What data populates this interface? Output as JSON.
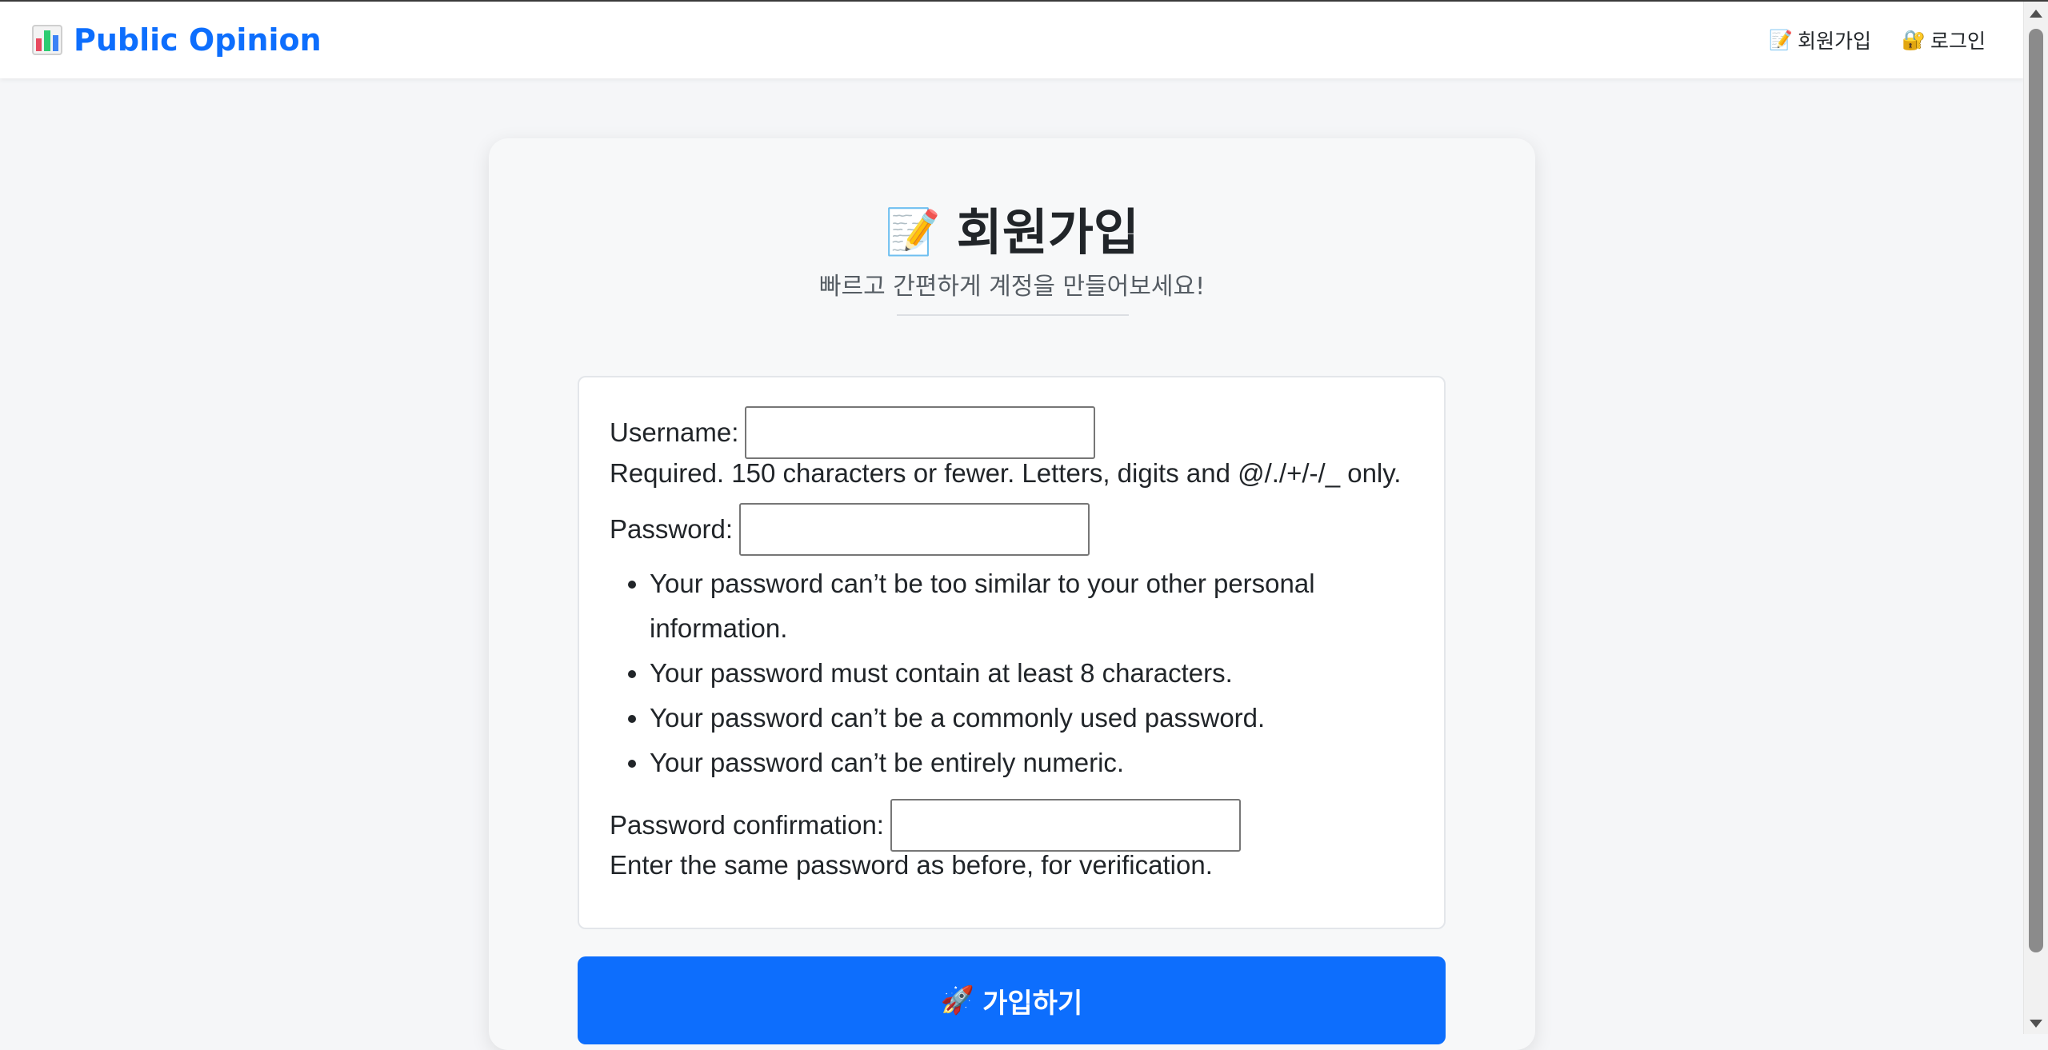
{
  "nav": {
    "brand": "Public Opinion",
    "brand_icon": "bar-chart-icon",
    "links": [
      {
        "icon": "📝",
        "label": "회원가입"
      },
      {
        "icon": "🔐",
        "label": "로그인"
      }
    ]
  },
  "signup": {
    "title_icon": "📝",
    "title": "회원가입",
    "subtitle": "빠르고 간편하게 계정을 만들어보세요!",
    "username_label": "Username:",
    "username_value": "",
    "username_help": "Required. 150 characters or fewer. Letters, digits and @/./+/-/_ only.",
    "password_label": "Password:",
    "password_value": "",
    "password_rules": [
      "Your password can’t be too similar to your other personal information.",
      "Your password must contain at least 8 characters.",
      "Your password can’t be a commonly used password.",
      "Your password can’t be entirely numeric."
    ],
    "password_confirm_label": "Password confirmation:",
    "password_confirm_value": "",
    "password_confirm_help": "Enter the same password as before, for verification.",
    "submit_icon": "🚀",
    "submit_label": "가입하기"
  },
  "colors": {
    "accent": "#0d6efd",
    "page_bg": "#f5f6f8",
    "card_bg": "#f7f8f9"
  }
}
